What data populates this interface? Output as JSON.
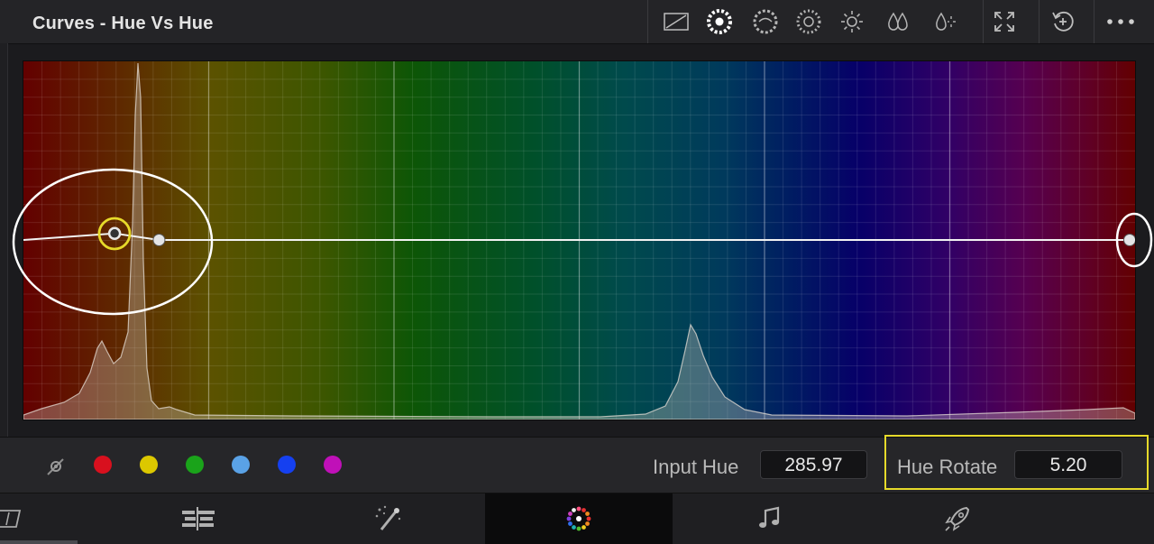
{
  "header": {
    "title": "Curves - Hue Vs Hue",
    "toolbar_icons": [
      "custom-curve-icon",
      "hue-vs-hue-icon",
      "hue-vs-sat-icon",
      "hue-vs-lum-icon",
      "lum-vs-sat-icon",
      "sat-vs-sat-icon",
      "sat-vs-lum-icon",
      "expand-icon",
      "reset-icon",
      "more-options-icon"
    ]
  },
  "curve": {
    "type": "Hue Vs Hue",
    "points": [
      {
        "hue": 0.0,
        "value": 0.0
      },
      {
        "hue": 0.082,
        "value": 0.018,
        "selected": true
      },
      {
        "hue": 0.122,
        "value": 0.0
      },
      {
        "hue": 1.0,
        "value": 0.0
      }
    ],
    "histogram_color": "#d8d0c8",
    "curve_color": "#f2f2f2",
    "annotation_color_white": "#ffffff",
    "annotation_color_yellow": "#e6da2a"
  },
  "swatches": [
    {
      "name": "picker",
      "color": "#8c8c8c"
    },
    {
      "name": "red",
      "color": "#d8101e"
    },
    {
      "name": "yellow",
      "color": "#dcc800"
    },
    {
      "name": "green",
      "color": "#1aa31a"
    },
    {
      "name": "cyan",
      "color": "#5aa2e6"
    },
    {
      "name": "blue",
      "color": "#1540f0"
    },
    {
      "name": "magenta",
      "color": "#c010b8"
    }
  ],
  "controls": {
    "input_hue_label": "Input Hue",
    "input_hue_value": "285.97",
    "hue_rotate_label": "Hue Rotate",
    "hue_rotate_value": "5.20"
  },
  "pages": [
    "cut-page",
    "edit-page",
    "fusion-page",
    "color-page",
    "fairlight-page",
    "deliver-page"
  ],
  "active_page": "color-page"
}
